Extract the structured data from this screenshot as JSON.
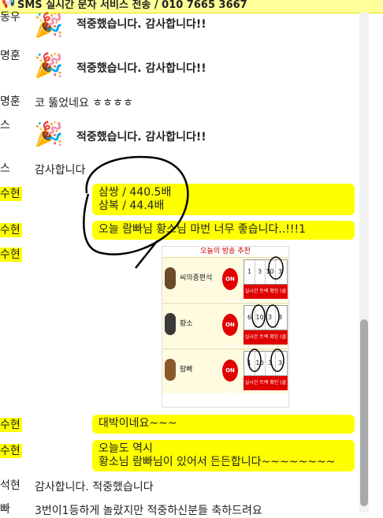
{
  "banner": {
    "icon": "megaphone-icon",
    "text": "SMS 실시간 문자 서비스 전송 / 010 7665 3667"
  },
  "messages": [
    {
      "name": "동우",
      "text": "적중했습니다. 감사합니다!!",
      "emoji": "🎉"
    },
    {
      "name": "명훈",
      "text": "적중했습니다. 감사합니다!!",
      "emoji": "🎉"
    },
    {
      "name": "명훈",
      "text": "코 뚫었네요 ㅎㅎㅎㅎ"
    },
    {
      "name": "스",
      "text": "적중했습니다. 감사합니다!!",
      "emoji": "🎉"
    },
    {
      "name": "스",
      "text": "감사합니다"
    },
    {
      "name": "수현",
      "lines": [
        "삼쌍 / 440.5배",
        "삼복 / 44.4배"
      ]
    },
    {
      "name": "수현",
      "text": "오늘 람빠님 황소님 마번 너무 좋습니다..!!!1"
    },
    {
      "name": "수현",
      "card": {
        "header": "오늘의 방송 추천",
        "rows": [
          {
            "label": "씨의종편석",
            "onair": "ON AIR",
            "cells": [
              "1",
              "3",
              "10",
              "3"
            ],
            "bar": "실시간 트랙 확인 (클릭)"
          },
          {
            "label": "황소",
            "onair": "ON AIR",
            "cells": [
              "6",
              "10",
              "3",
              "3"
            ],
            "bar": "실시간 트랙 확인 (클릭)"
          },
          {
            "label": "람빠",
            "onair": "ON AIR",
            "cells": [
              "1",
              "10",
              "3",
              "3"
            ],
            "bar": "실시간 트랙 확인 (클릭)"
          }
        ]
      }
    },
    {
      "name": "수현",
      "text": "대박이네요~~~"
    },
    {
      "name": "수현",
      "lines": [
        "오늘도 역시",
        "황소님 람빠님이 있어서 든든합니다~~~~~~~~"
      ]
    },
    {
      "name": "석현",
      "text": "감사합니다. 적중했습니다"
    },
    {
      "name": "빠",
      "text": "3번이1등하게 놀랐지만 적중하신분들 축하드려요"
    }
  ],
  "colors": {
    "highlight": "#ffff00",
    "banner": "#ffff99",
    "onair": "#e00000"
  }
}
